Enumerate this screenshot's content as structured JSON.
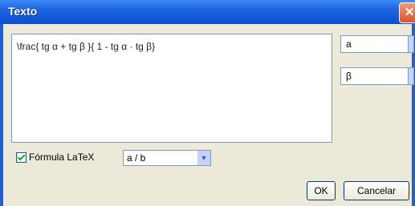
{
  "window": {
    "title": "Texto",
    "close_label": "✕"
  },
  "editor": {
    "text": "\\frac{ tg α + tg β }{ 1 - tg α · tg β}"
  },
  "symbols": [
    {
      "value": "a"
    },
    {
      "value": "β"
    }
  ],
  "latex": {
    "label": "Fórmula LaTeX",
    "checked": true,
    "format_value": "a / b",
    "format_arrow": "▼"
  },
  "buttons": {
    "ok_label": "OK",
    "cancel_label": "Cancelar"
  }
}
